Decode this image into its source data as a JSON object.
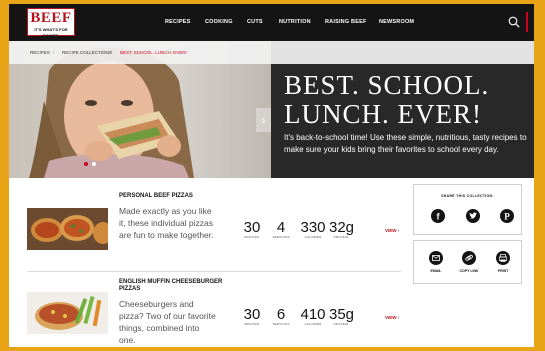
{
  "header": {
    "logo_main": "BEEF",
    "logo_tagline": "IT'S WHAT'S FOR DINNER.",
    "nav": [
      "RECIPES",
      "COOKING",
      "CUTS",
      "NUTRITION",
      "RAISING BEEF",
      "NEWSROOM"
    ],
    "accent_color": "#d0021b"
  },
  "breadcrumb": {
    "items": [
      "RECIPES",
      "RECIPE COLLECTIONS",
      "BEST. SCHOOL. LUNCH. EVER!"
    ],
    "separator": "/"
  },
  "hero": {
    "title": "BEST. SCHOOL. LUNCH. EVER!",
    "description": "It's back-to-school time! Use these simple, nutritious, tasty recipes to make sure your kids bring their favorites to school every day.",
    "next_arrow": "›"
  },
  "recipes": [
    {
      "title": "PERSONAL BEEF PIZZAS",
      "description": "Made exactly as you like it, these individual pizzas are fun to make together.",
      "minutes": "30",
      "minutes_label": "MINUTES",
      "servings": "4",
      "servings_label": "SERVINGS",
      "calories": "330",
      "calories_label": "CALORIES",
      "protein": "32g",
      "protein_label": "PROTEIN",
      "view_label": "VIEW ›"
    },
    {
      "title": "ENGLISH MUFFIN CHEESEBURGER PIZZAS",
      "description": "Cheeseburgers and pizza? Two of our favorite things, combined into one.",
      "minutes": "30",
      "minutes_label": "MINUTES",
      "servings": "6",
      "servings_label": "SERVINGS",
      "calories": "410",
      "calories_label": "CALORIES",
      "protein": "35g",
      "protein_label": "PROTEIN",
      "view_label": "VIEW ›"
    }
  ],
  "share": {
    "title": "SHARE THIS COLLECTION:",
    "icons": [
      "facebook-icon",
      "twitter-icon",
      "pinterest-icon"
    ],
    "facebook_glyph": "f",
    "pinterest_glyph": "P"
  },
  "actions": {
    "email_label": "EMAIL",
    "copy_link_label": "COPY LINK",
    "print_label": "PRINT"
  }
}
